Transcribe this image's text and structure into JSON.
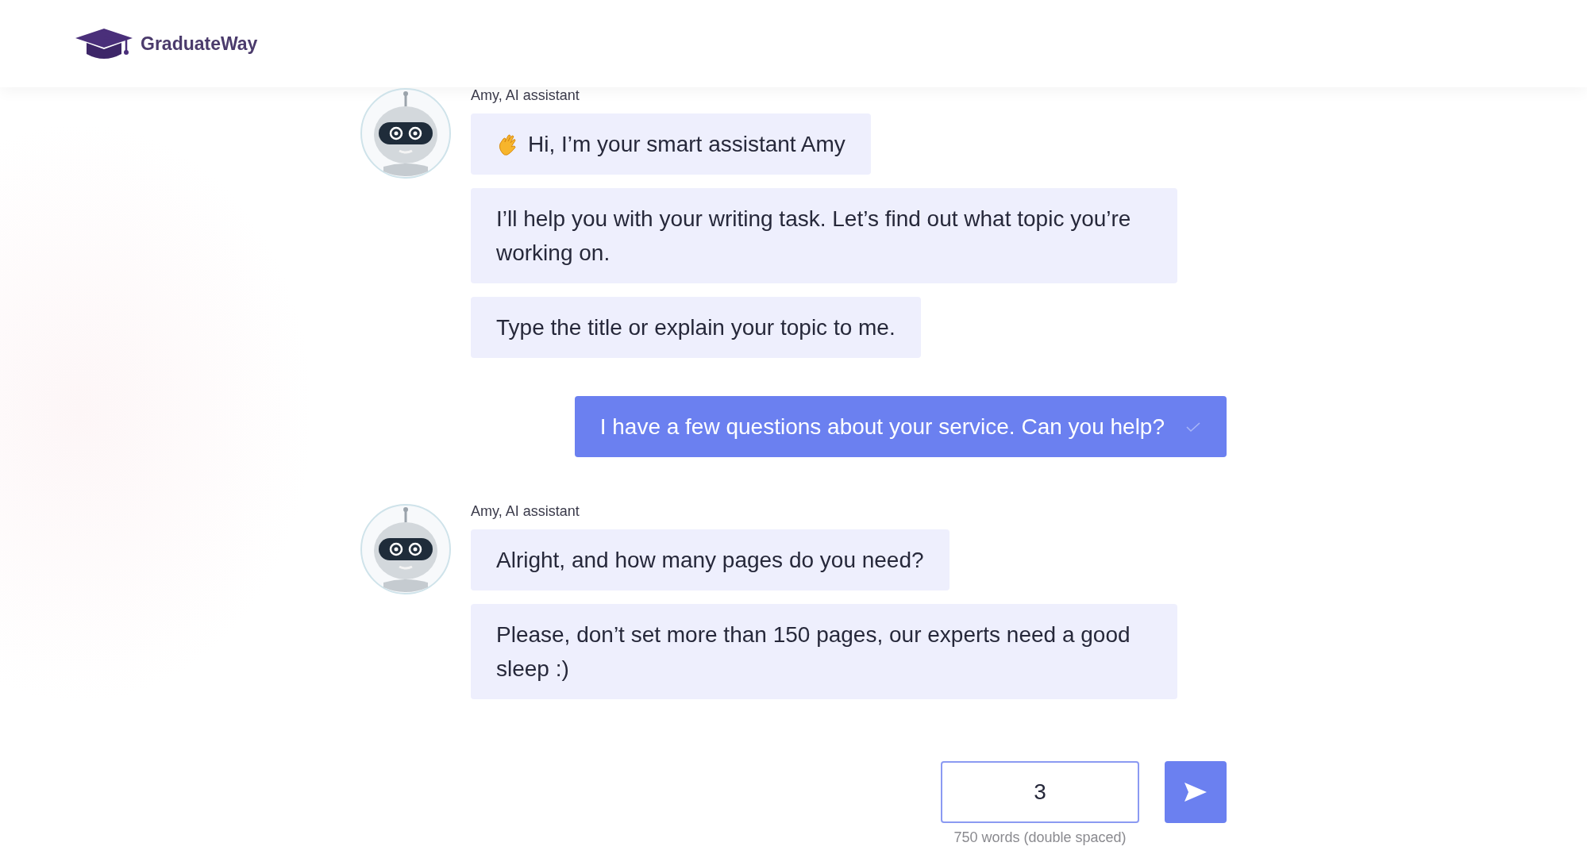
{
  "header": {
    "logo_text": "GraduateWay"
  },
  "messages": [
    {
      "kind": "bot",
      "sender": "Amy, AI assistant",
      "bubbles": [
        {
          "text": "Hi, I’m your smart assistant Amy"
        },
        {
          "text": "I’ll help you with your writing task. Let’s find out what topic you’re working on."
        },
        {
          "text": "Type the title or explain your topic to me."
        }
      ]
    },
    {
      "kind": "user",
      "text": "I have a few questions about your service. Can you help?",
      "delivered": true
    },
    {
      "kind": "bot",
      "sender": "Amy, AI assistant",
      "bubbles": [
        {
          "text": "Alright, and how many pages do you need?"
        },
        {
          "text": "Please, don’t set more than 150 pages, our experts need a good sleep :)"
        }
      ]
    }
  ],
  "composer": {
    "value": "3",
    "hint": "750 words (double spaced)"
  }
}
